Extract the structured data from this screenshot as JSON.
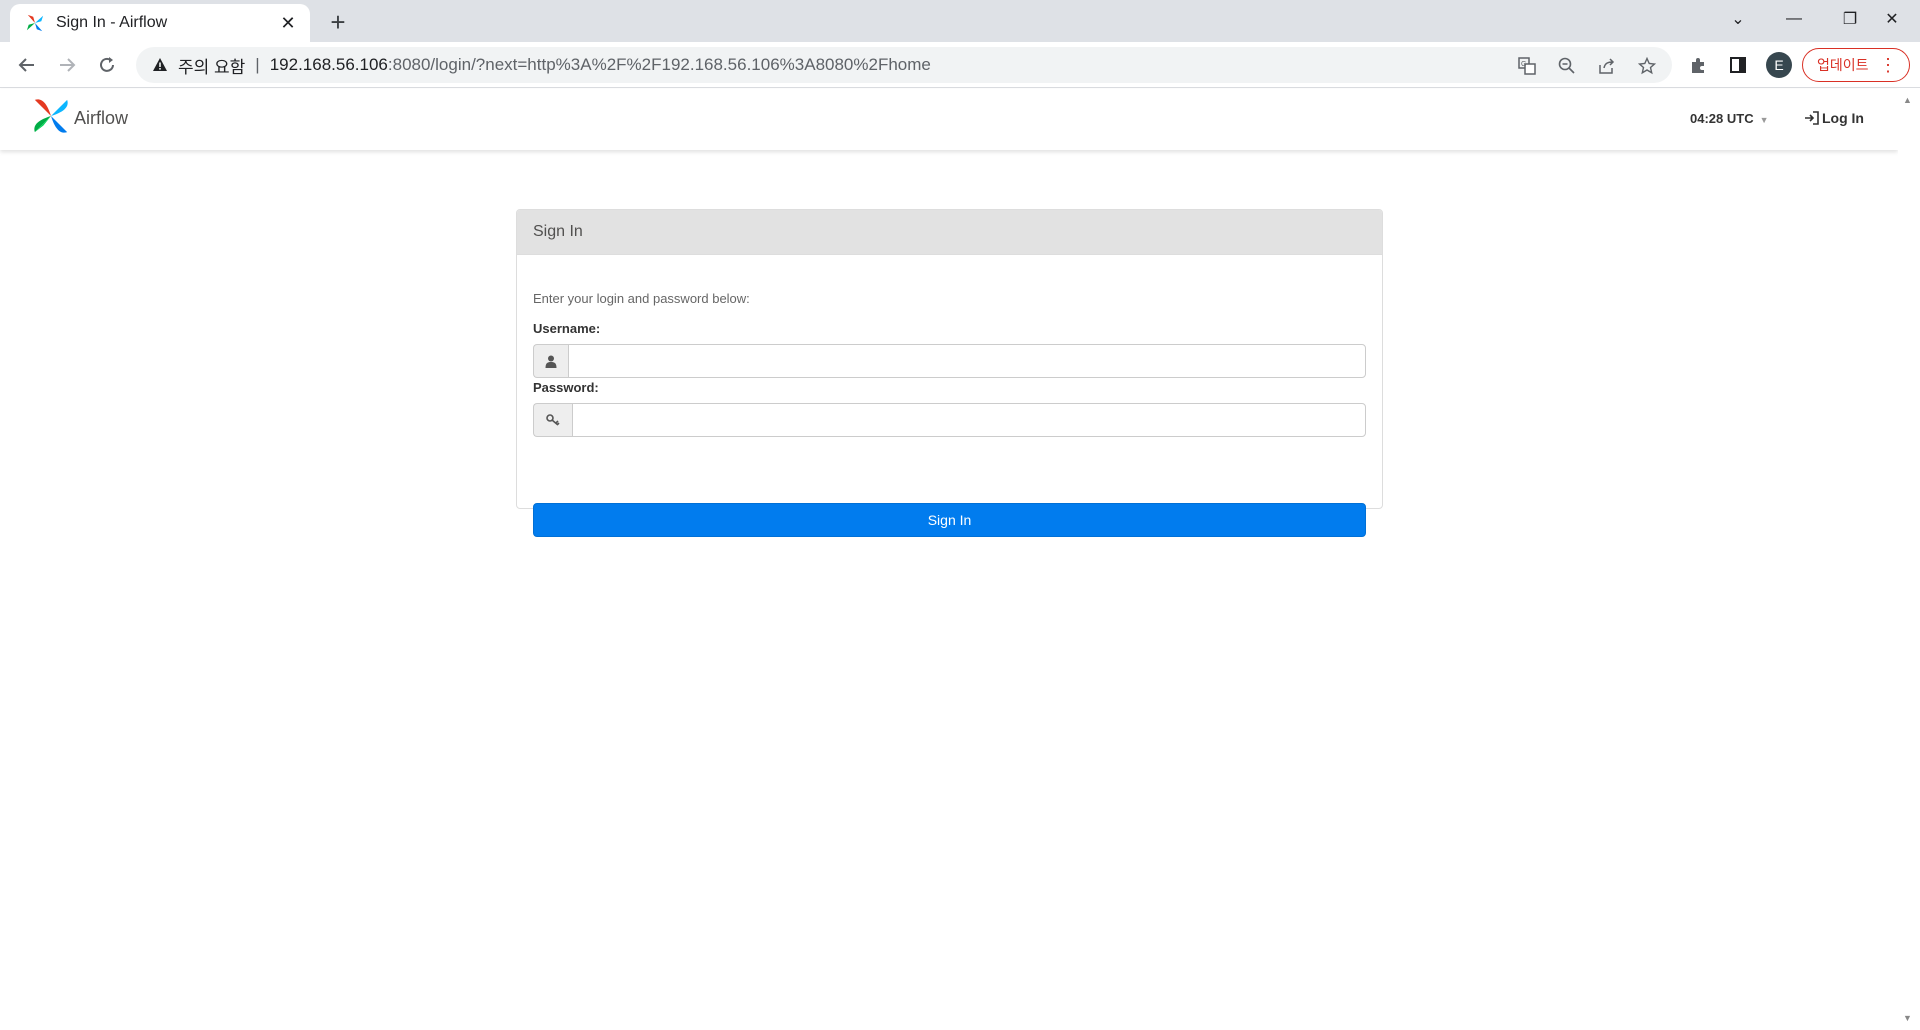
{
  "browser": {
    "tab": {
      "title": "Sign In - Airflow",
      "close_glyph": "✕"
    },
    "new_tab_glyph": "+",
    "window_controls": {
      "list_tabs": "⌄",
      "minimize": "—",
      "restore": "❐",
      "close": "✕"
    },
    "address_bar": {
      "security_label": "주의 요함",
      "separator": "|",
      "url_host": "192.168.56.106",
      "url_rest": ":8080/login/?next=http%3A%2F%2F192.168.56.106%3A8080%2Fhome"
    },
    "profile_initial": "E",
    "update_label": "업데이트",
    "update_menu_glyph": "⋮"
  },
  "navbar": {
    "brand": "Airflow",
    "clock": "04:28 UTC",
    "clock_caret": "▼",
    "login": "Log In"
  },
  "login_panel": {
    "heading": "Sign In",
    "intro": "Enter your login and password below:",
    "username_label": "Username:",
    "username_value": "",
    "password_label": "Password:",
    "password_value": "",
    "submit_label": "Sign In"
  },
  "colors": {
    "primary_button": "#017cee",
    "panel_heading_bg": "#e2e2e2",
    "update_red": "#d93025",
    "logo_colors": [
      "#e43921",
      "#00ad46",
      "#04d659",
      "#0cb6ff",
      "#017cee"
    ]
  },
  "icons": [
    "airflow-favicon-icon",
    "warning-icon",
    "back-arrow-icon",
    "forward-arrow-icon",
    "reload-icon",
    "translate-icon",
    "zoom-out-icon",
    "share-icon",
    "star-icon",
    "extensions-icon",
    "side-panel-icon",
    "user-icon",
    "key-icon",
    "login-icon"
  ]
}
